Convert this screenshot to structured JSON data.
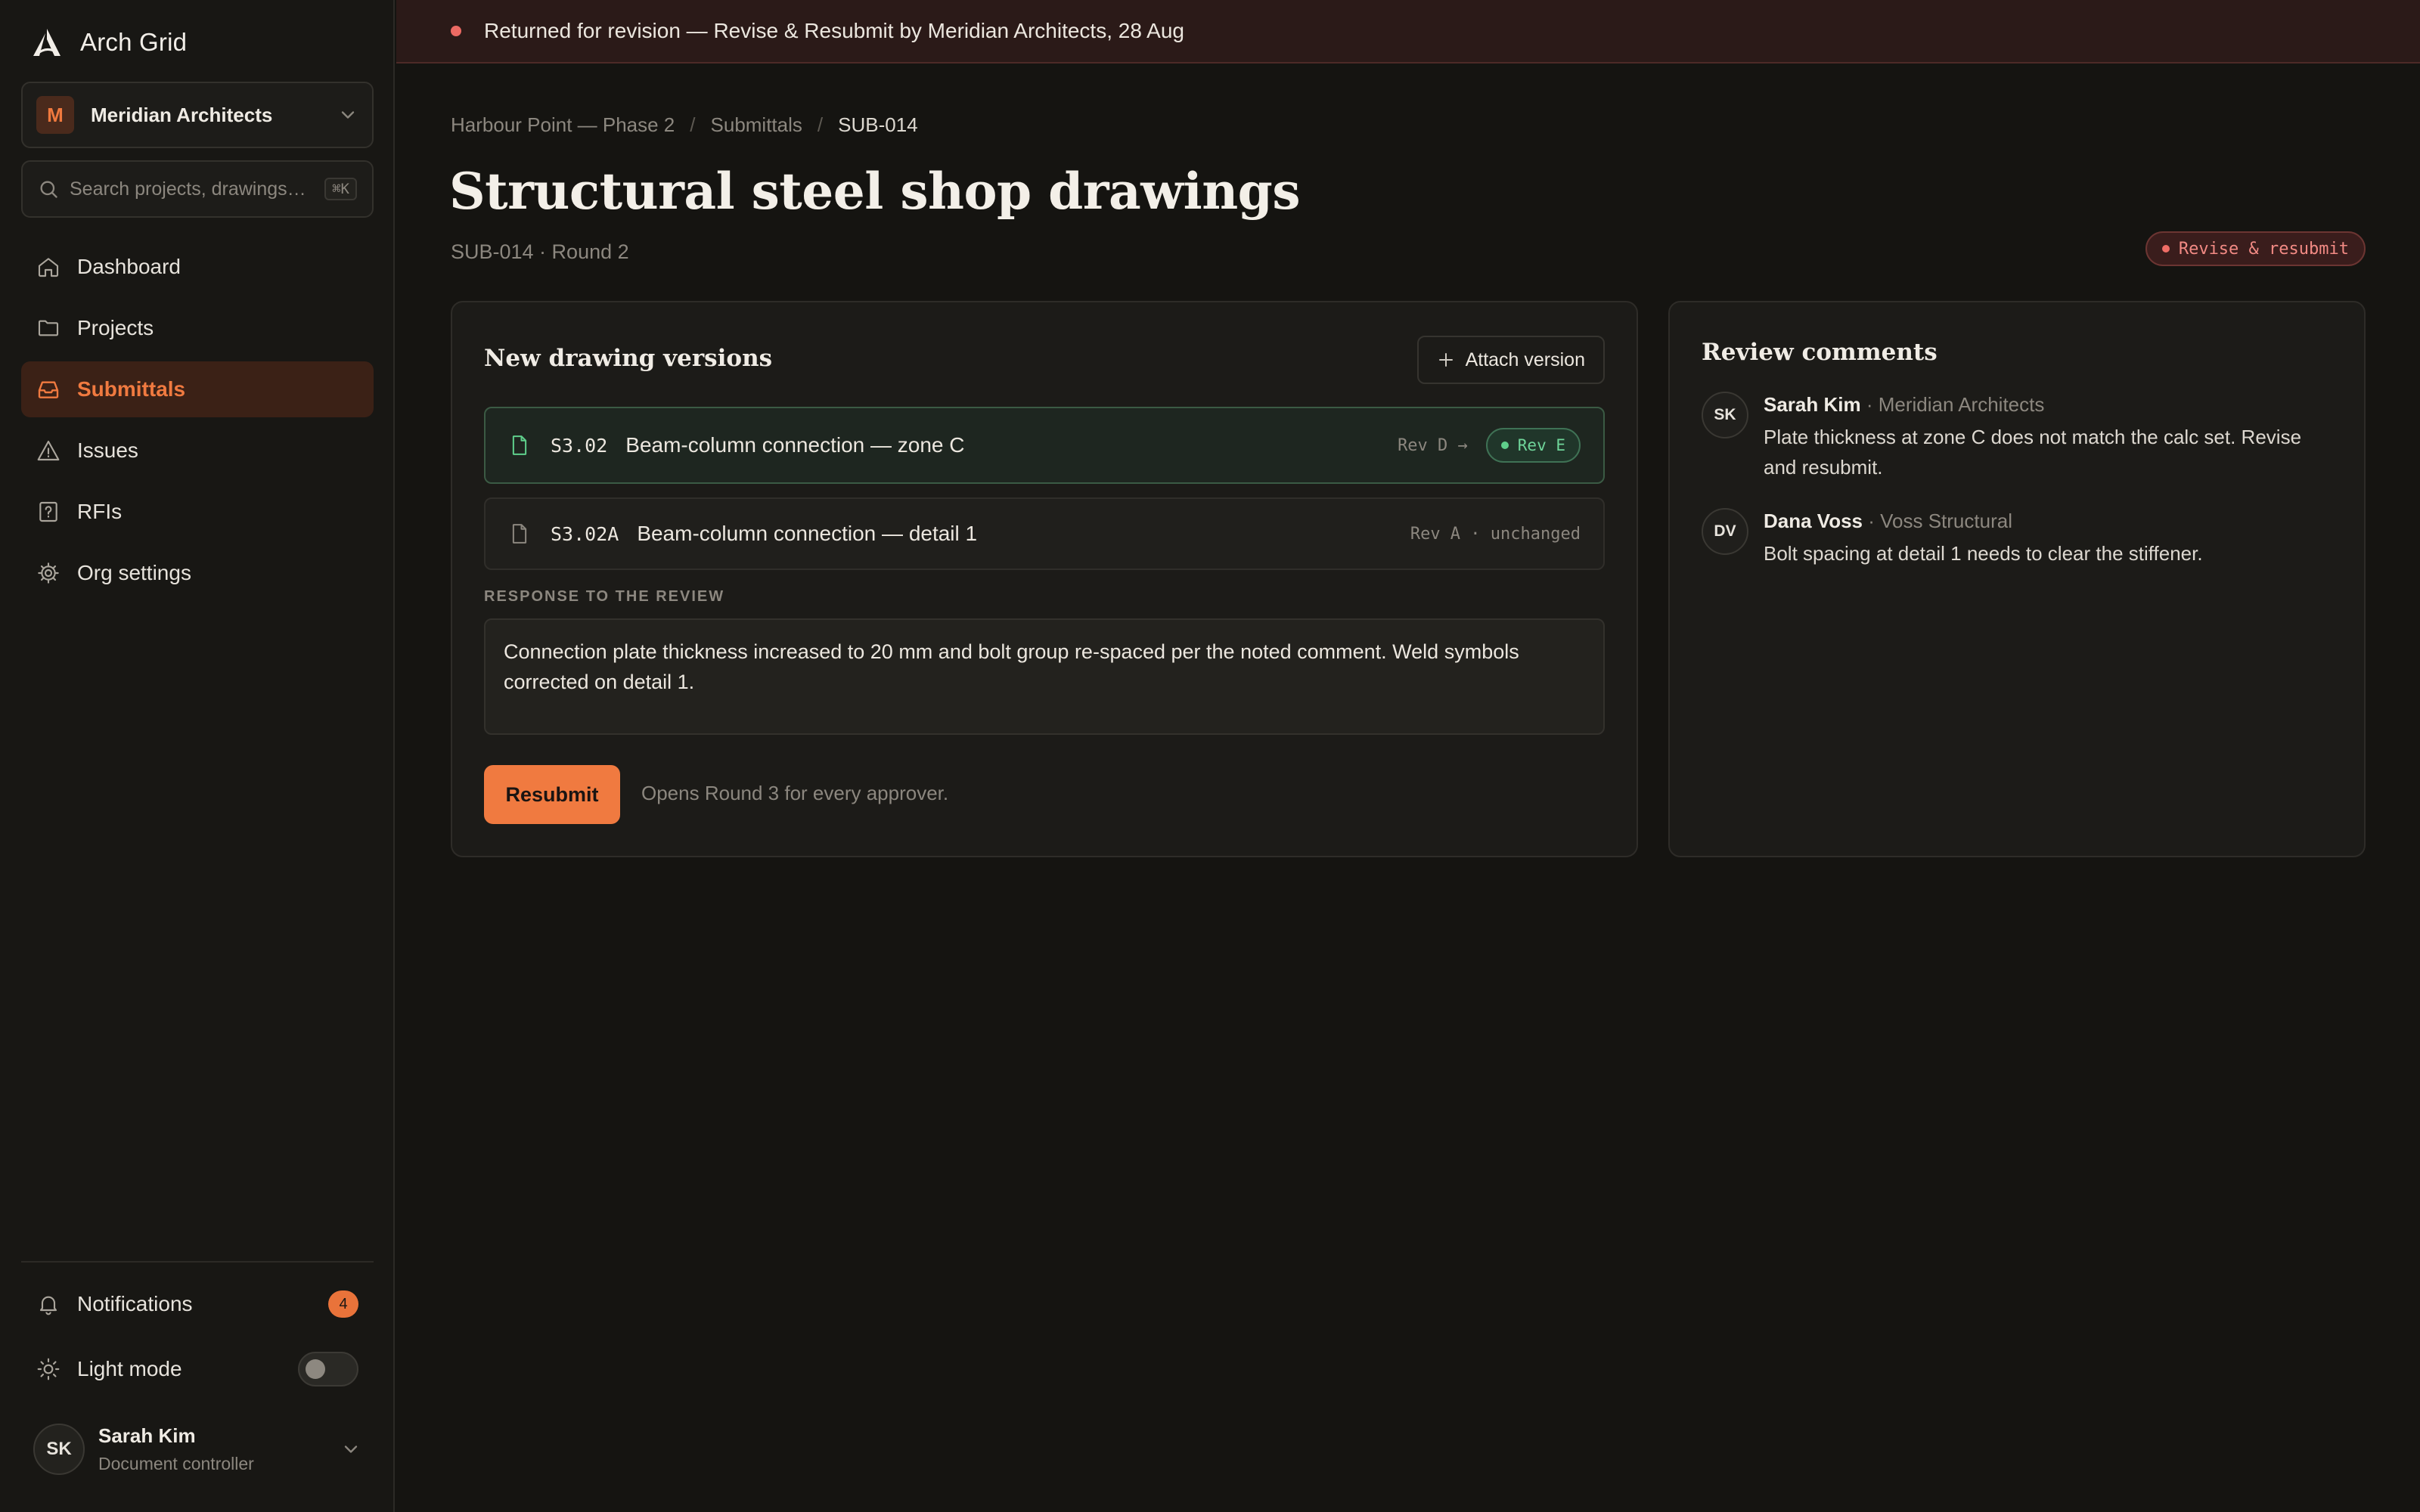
{
  "app": {
    "name": "Arch Grid"
  },
  "org": {
    "avatar_initial": "M",
    "name": "Meridian Architects"
  },
  "search": {
    "placeholder": "Search projects, drawings…",
    "shortcut": "⌘K"
  },
  "nav": {
    "items": [
      {
        "label": "Dashboard",
        "icon": "home-icon"
      },
      {
        "label": "Projects",
        "icon": "folder-icon"
      },
      {
        "label": "Submittals",
        "icon": "inbox-icon",
        "active": true
      },
      {
        "label": "Issues",
        "icon": "warning-icon"
      },
      {
        "label": "RFIs",
        "icon": "question-icon"
      },
      {
        "label": "Org settings",
        "icon": "gear-icon"
      }
    ]
  },
  "notifications": {
    "label": "Notifications",
    "count": "4"
  },
  "theme": {
    "label": "Light mode",
    "enabled": false
  },
  "user": {
    "initials": "SK",
    "name": "Sarah Kim",
    "role": "Document controller"
  },
  "alert": {
    "text": "Returned for revision — Revise & Resubmit by Meridian Architects, 28 Aug"
  },
  "breadcrumb": [
    "Harbour Point — Phase 2",
    "Submittals",
    "SUB-014"
  ],
  "page": {
    "title": "Structural steel shop drawings",
    "subtitle": "SUB-014 · Round 2",
    "status": "Revise & resubmit"
  },
  "versions": {
    "title": "New drawing versions",
    "attach_label": "Attach version",
    "rows": [
      {
        "code": "S3.02",
        "title": "Beam-column connection — zone C",
        "rev_from": "Rev D →",
        "rev_to": "Rev E"
      },
      {
        "code": "S3.02A",
        "title": "Beam-column connection — detail 1",
        "status": "Rev A · unchanged"
      }
    ],
    "response_label": "RESPONSE TO THE REVIEW",
    "response_text": "Connection plate thickness increased to 20 mm and bolt group re-spaced per the noted comment. Weld symbols corrected on detail 1.",
    "resubmit_label": "Resubmit",
    "resubmit_hint": "Opens Round 3 for every approver."
  },
  "comments": {
    "title": "Review comments",
    "items": [
      {
        "initials": "SK",
        "author": "Sarah Kim",
        "org": " · Meridian Architects",
        "text": "Plate thickness at zone C does not match the calc set. Revise and resubmit."
      },
      {
        "initials": "DV",
        "author": "Dana Voss",
        "org": " · Voss Structural",
        "text": "Bolt spacing at detail 1 needs to clear the stiffener."
      }
    ]
  },
  "colors": {
    "accent": "#f07a40",
    "background": "#151411",
    "alert": "#ec6a63",
    "success": "#5fcf8b"
  }
}
